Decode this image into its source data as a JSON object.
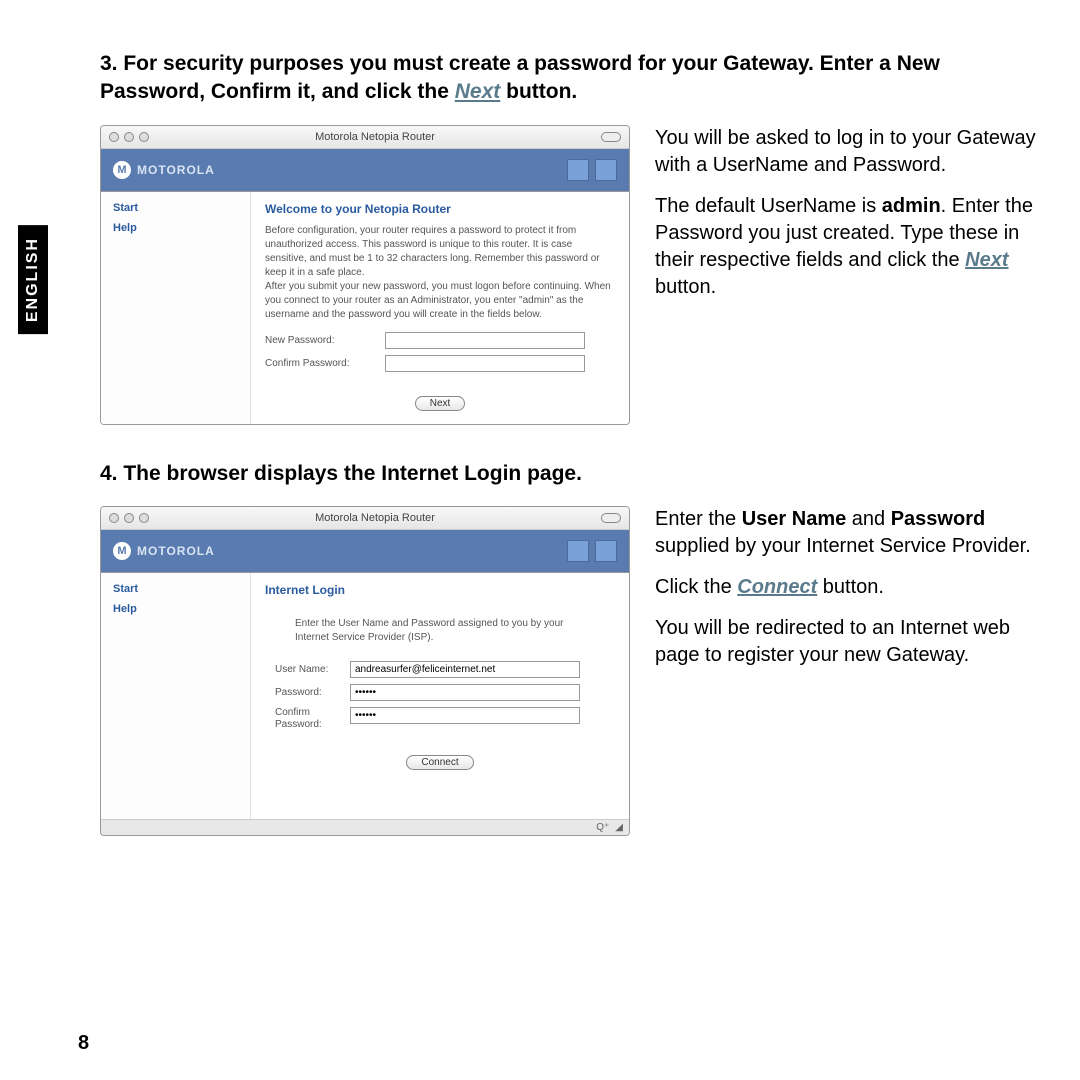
{
  "sideTab": "ENGLISH",
  "pageNumber": "8",
  "step3": {
    "heading_pre": "3. For security purposes you must create a password for your Gateway. Enter a New Password, Confirm it, and click the ",
    "heading_link": "Next",
    "heading_post": " button.",
    "desc": {
      "p1": "You will be asked to log in to your Gateway with a UserName and Password.",
      "p2_pre": "The default UserName is ",
      "p2_bold": "admin",
      "p2_mid": ". Enter the Password you just created. Type these in their respective fields and click the ",
      "p2_link": "Next",
      "p2_post": " button."
    },
    "shot": {
      "title": "Motorola Netopia Router",
      "brand": "MOTOROLA",
      "nav": {
        "start": "Start",
        "help": "Help"
      },
      "contentTitle": "Welcome to your Netopia Router",
      "blurb": "Before configuration, your router requires a password to protect it from unauthorized access. This password is unique to this router. It is case sensitive, and must be 1 to 32 characters long. Remember this password or keep it in a safe place.\nAfter you submit your new password, you must logon before continuing. When you connect to your router as an Administrator, you enter \"admin\" as the username and the password you will create in the fields below.",
      "newPw": "New Password:",
      "confirmPw": "Confirm Password:",
      "button": "Next"
    }
  },
  "step4": {
    "heading": "4. The browser displays the Internet Login page.",
    "desc": {
      "p1_pre": "Enter the ",
      "p1_b1": "User Name",
      "p1_mid1": " and ",
      "p1_b2": "Password",
      "p1_post": " supplied by your Internet Service Provider.",
      "p2_pre": "Click the ",
      "p2_link": "Connect",
      "p2_post": " button.",
      "p3": "You will be redirected to an Internet web page to register your new Gateway."
    },
    "shot": {
      "title": "Motorola Netopia Router",
      "brand": "MOTOROLA",
      "nav": {
        "start": "Start",
        "help": "Help"
      },
      "contentTitle": "Internet Login",
      "blurb": "Enter the User Name and Password assigned to you by your Internet Service Provider (ISP).",
      "userName": "User Name:",
      "userValue": "andreasurfer@feliceinternet.net",
      "password": "Password:",
      "passwordValue": "••••••",
      "confirm": "Confirm Password:",
      "confirmValue": "••••••",
      "button": "Connect"
    }
  }
}
